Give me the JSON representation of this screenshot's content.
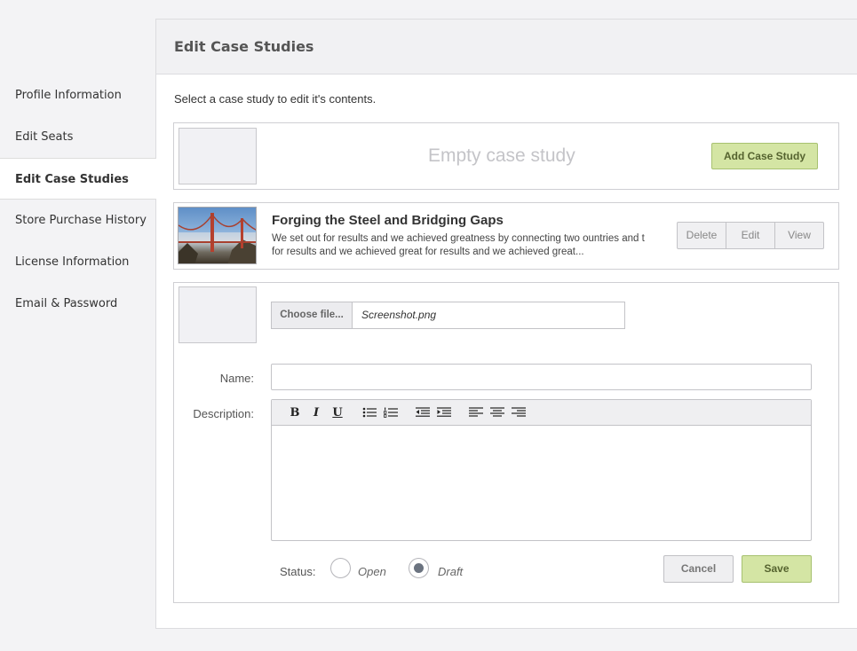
{
  "sidebar": {
    "items": [
      {
        "label": "Profile Information"
      },
      {
        "label": "Edit Seats"
      },
      {
        "label": "Edit Case Studies"
      },
      {
        "label": "Store Purchase History"
      },
      {
        "label": "License Information"
      },
      {
        "label": "Email & Password"
      }
    ],
    "active_index": 2
  },
  "header": {
    "title": "Edit Case Studies"
  },
  "intro": "Select a case study to edit it's contents.",
  "empty_card": {
    "text": "Empty case study",
    "add_button": "Add Case Study"
  },
  "case_study": {
    "title": "Forging the Steel and Bridging Gaps",
    "description": "We set out for results and we achieved greatness by connecting two ountries and t for results and we achieved great for results and we achieved great...",
    "actions": {
      "delete": "Delete",
      "edit": "Edit",
      "view": "View"
    }
  },
  "form": {
    "choose_file": "Choose file...",
    "file_name": "Screenshot.png",
    "name_label": "Name:",
    "name_value": "",
    "description_label": "Description:",
    "description_value": "",
    "status_label": "Status:",
    "status_options": [
      "Open",
      "Draft"
    ],
    "status_selected": "Draft",
    "cancel": "Cancel",
    "save": "Save"
  },
  "toolbar_icons": [
    "bold-icon",
    "italic-icon",
    "underline-icon",
    "bullet-list-icon",
    "numbered-list-icon",
    "outdent-icon",
    "indent-icon",
    "align-left-icon",
    "align-center-icon",
    "align-right-icon"
  ],
  "colors": {
    "accent_green": "#d4e5a4",
    "accent_green_border": "#a7c170",
    "background": "#f3f3f5"
  }
}
